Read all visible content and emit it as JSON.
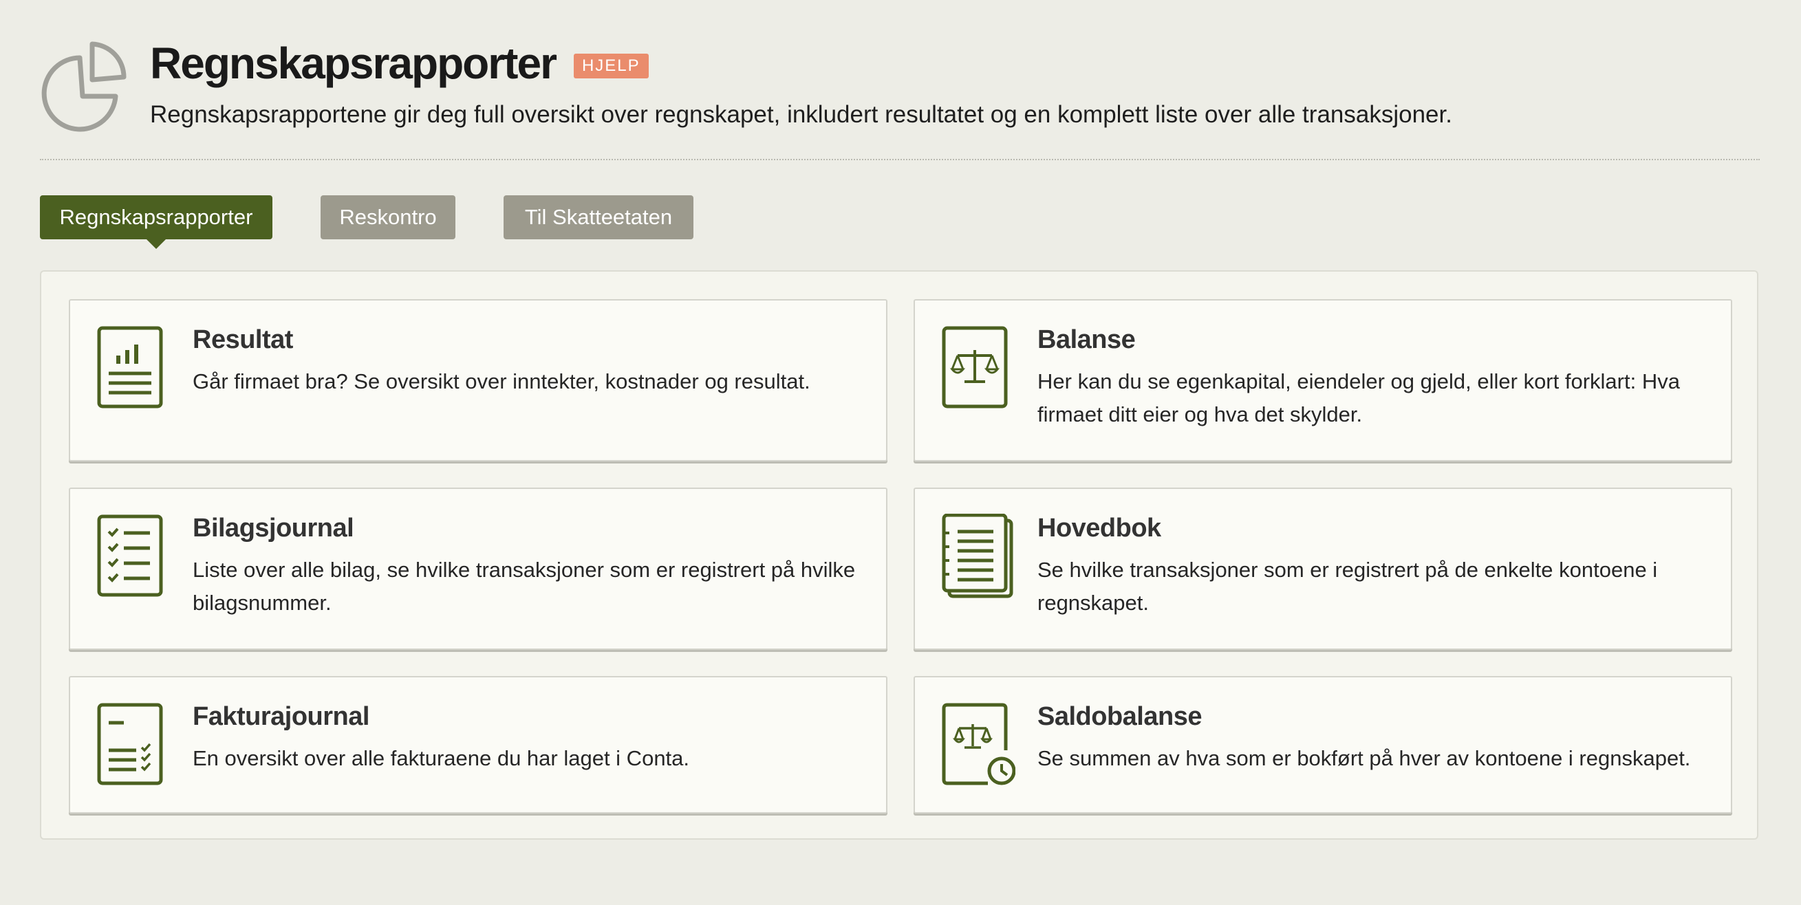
{
  "header": {
    "title": "Regnskapsrapporter",
    "help_label": "HJELP",
    "subtitle": "Regnskapsrapportene gir deg full oversikt over regnskapet, inkludert resultatet og en komplett liste over alle transaksjoner."
  },
  "tabs": [
    {
      "label": "Regnskapsrapporter",
      "active": true
    },
    {
      "label": "Reskontro",
      "active": false
    },
    {
      "label": "Til Skatteetaten",
      "active": false
    }
  ],
  "cards": [
    {
      "title": "Resultat",
      "description": "Går firmaet bra? Se oversikt over inntekter, kostnader og resultat.",
      "icon": "report-chart-icon"
    },
    {
      "title": "Balanse",
      "description": "Her kan du se egenkapital, eiendeler og gjeld, eller kort forklart: Hva firmaet ditt eier og hva det skylder.",
      "icon": "scales-document-icon"
    },
    {
      "title": "Bilagsjournal",
      "description": "Liste over alle bilag, se hvilke transaksjoner som er registrert på hvilke bilagsnummer.",
      "icon": "checklist-document-icon"
    },
    {
      "title": "Hovedbok",
      "description": "Se hvilke transaksjoner som er registrert på de enkelte kontoene i regnskapet.",
      "icon": "ledger-book-icon"
    },
    {
      "title": "Fakturajournal",
      "description": "En oversikt over alle fakturaene du har laget i Conta.",
      "icon": "invoice-list-icon"
    },
    {
      "title": "Saldobalanse",
      "description": "Se summen av hva som er bokført på hver av kontoene i regnskapet.",
      "icon": "scales-clock-icon"
    }
  ],
  "colors": {
    "accent_green": "#4b6020",
    "inactive_tab": "#9c9a8d",
    "help_badge": "#ea8c6c",
    "background": "#edede6"
  }
}
